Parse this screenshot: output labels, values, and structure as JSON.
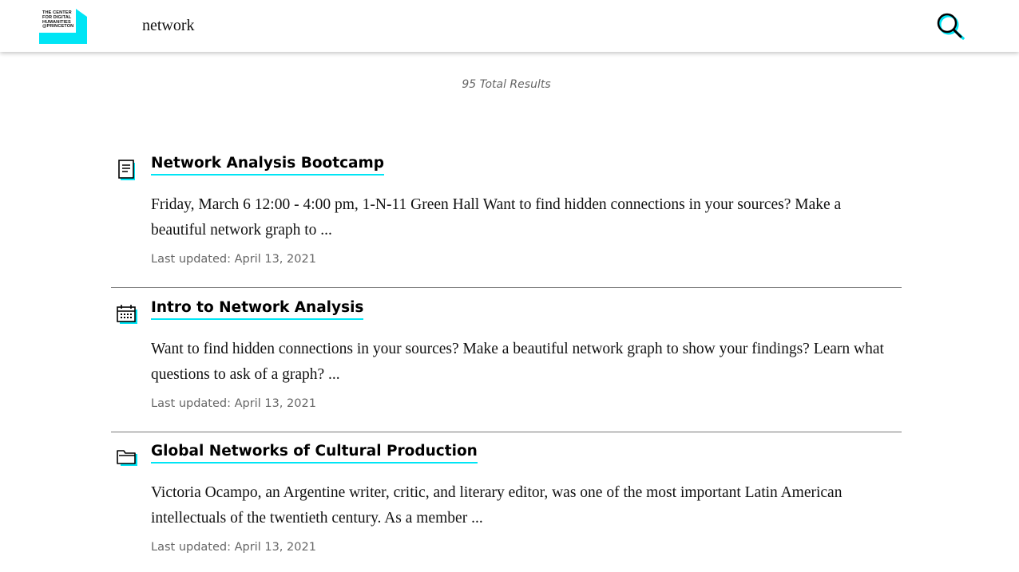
{
  "header": {
    "logo_lines": [
      "THE CENTER",
      "FOR DIGITAL",
      "HUMANITIES",
      "@PRINCETON"
    ],
    "search_value": "network",
    "search_icon": "magnifier-icon"
  },
  "results": {
    "total_label": "95 Total Results",
    "items": [
      {
        "icon": "document-icon",
        "title": "Network Analysis Bootcamp",
        "excerpt": "Friday, March 6 12:00 - 4:00 pm, 1-N-11 Green Hall   Want to find hidden connections in your sources? Make a beautiful network graph to ...",
        "updated": "Last updated: April 13, 2021"
      },
      {
        "icon": "calendar-icon",
        "title": "Intro to Network Analysis",
        "excerpt": "Want to find hidden connections in your sources? Make a beautiful network graph to show your findings? Learn what questions to ask of a graph? ...",
        "updated": "Last updated: April 13, 2021"
      },
      {
        "icon": "folder-icon",
        "title": "Global Networks of Cultural Production",
        "excerpt": "Victoria Ocampo, an Argentine writer, critic, and literary editor, was one of the most important Latin American intellectuals of the twentieth century. As a member ...",
        "updated": "Last updated: April 13, 2021"
      }
    ]
  },
  "colors": {
    "accent": "#00e5f5",
    "text": "#111111",
    "muted": "#666666",
    "divider": "#777777"
  }
}
